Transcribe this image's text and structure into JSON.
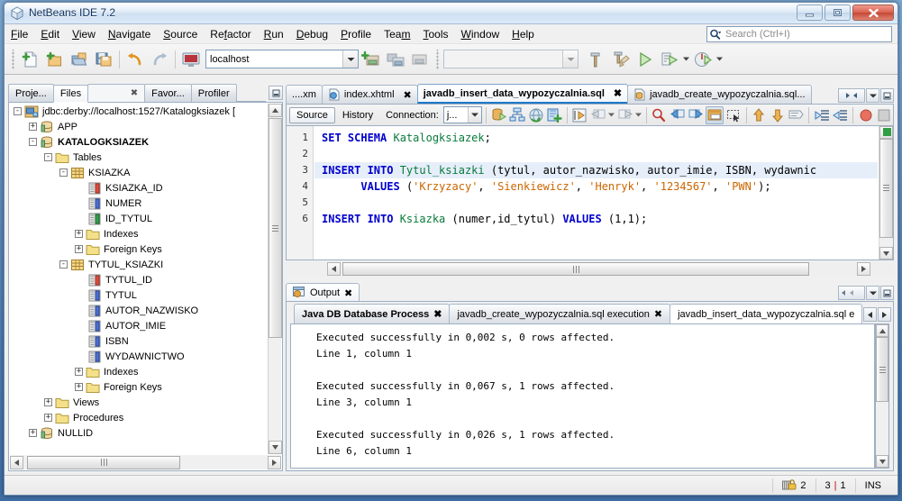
{
  "window": {
    "title": "NetBeans IDE 7.2",
    "app_icon": "netbeans-cube-icon",
    "minimize": "minimize-icon",
    "maximize": "maximize-icon",
    "close": "close-icon"
  },
  "menubar": {
    "items": [
      {
        "label": "File",
        "mnemonic": "F"
      },
      {
        "label": "Edit",
        "mnemonic": "E"
      },
      {
        "label": "View",
        "mnemonic": "V"
      },
      {
        "label": "Navigate",
        "mnemonic": "N"
      },
      {
        "label": "Source",
        "mnemonic": "S"
      },
      {
        "label": "Refactor",
        "mnemonic": "R"
      },
      {
        "label": "Run",
        "mnemonic": "R"
      },
      {
        "label": "Debug",
        "mnemonic": "D"
      },
      {
        "label": "Profile",
        "mnemonic": "P"
      },
      {
        "label": "Team",
        "mnemonic": "m"
      },
      {
        "label": "Tools",
        "mnemonic": "T"
      },
      {
        "label": "Window",
        "mnemonic": "W"
      },
      {
        "label": "Help",
        "mnemonic": "H"
      }
    ]
  },
  "search": {
    "placeholder": "Search (Ctrl+I)",
    "value": "",
    "icon": "search-magnifier-icon"
  },
  "toolbar": {
    "buttons": [
      {
        "name": "new-file-button",
        "icon": "new-file-icon"
      },
      {
        "name": "new-project-button",
        "icon": "new-project-icon"
      },
      {
        "name": "open-project-button",
        "icon": "open-project-icon"
      },
      {
        "name": "save-all-button",
        "icon": "save-all-icon"
      },
      {
        "name": "undo-button",
        "icon": "undo-arrow-icon"
      },
      {
        "name": "redo-button",
        "icon": "redo-arrow-icon"
      }
    ],
    "config_combo": {
      "value": "localhost",
      "name": "server-config-combo"
    },
    "project_combo": {
      "value": "",
      "name": "project-config-combo"
    },
    "right_buttons": [
      {
        "name": "build-project-button",
        "icon": "hammer-icon"
      },
      {
        "name": "clean-build-button",
        "icon": "hammer-broom-icon"
      },
      {
        "name": "run-project-button",
        "icon": "green-play-icon"
      },
      {
        "name": "debug-project-button",
        "icon": "debug-icon"
      },
      {
        "name": "profile-project-button",
        "icon": "profile-gauge-icon"
      }
    ]
  },
  "explorer": {
    "tabs": [
      {
        "label": "Proje...",
        "name": "tab-projects",
        "active": false,
        "closable": false
      },
      {
        "label": "Files",
        "name": "tab-files",
        "active": true,
        "closable": false
      },
      {
        "label": "Favor...",
        "name": "tab-favorites",
        "active": false,
        "closable": false
      },
      {
        "label": "Profiler",
        "name": "tab-profiler",
        "active": false,
        "closable": false
      }
    ],
    "close_marker": "✖",
    "minimize_icon": "minimize-window-icon",
    "tree": [
      {
        "label": "jdbc:derby://localhost:1527/Katalogksiazek [",
        "indent": 1,
        "expander": "-",
        "icon": "database-connection-icon",
        "bold": false
      },
      {
        "label": "APP",
        "indent": 2,
        "expander": "+",
        "icon": "schema-icon",
        "bold": false
      },
      {
        "label": "KATALOGKSIAZEK",
        "indent": 2,
        "expander": "-",
        "icon": "schema-icon",
        "bold": true
      },
      {
        "label": "Tables",
        "indent": 3,
        "expander": "-",
        "icon": "folder-icon",
        "bold": false
      },
      {
        "label": "KSIAZKA",
        "indent": 4,
        "expander": "-",
        "icon": "table-icon",
        "bold": false
      },
      {
        "label": "KSIAZKA_ID",
        "indent": 5,
        "expander": "",
        "icon": "column-key-red-icon",
        "bold": false
      },
      {
        "label": "NUMER",
        "indent": 5,
        "expander": "",
        "icon": "column-blue-icon",
        "bold": false
      },
      {
        "label": "ID_TYTUL",
        "indent": 5,
        "expander": "",
        "icon": "column-green-icon",
        "bold": false
      },
      {
        "label": "Indexes",
        "indent": 5,
        "expander": "+",
        "icon": "folder-icon",
        "bold": false
      },
      {
        "label": "Foreign Keys",
        "indent": 5,
        "expander": "+",
        "icon": "folder-icon",
        "bold": false
      },
      {
        "label": "TYTUL_KSIAZKI",
        "indent": 4,
        "expander": "-",
        "icon": "table-icon",
        "bold": false
      },
      {
        "label": "TYTUL_ID",
        "indent": 5,
        "expander": "",
        "icon": "column-key-red-icon",
        "bold": false
      },
      {
        "label": "TYTUL",
        "indent": 5,
        "expander": "",
        "icon": "column-blue-icon",
        "bold": false
      },
      {
        "label": "AUTOR_NAZWISKO",
        "indent": 5,
        "expander": "",
        "icon": "column-blue-icon",
        "bold": false
      },
      {
        "label": "AUTOR_IMIE",
        "indent": 5,
        "expander": "",
        "icon": "column-blue-icon",
        "bold": false
      },
      {
        "label": "ISBN",
        "indent": 5,
        "expander": "",
        "icon": "column-blue-icon",
        "bold": false
      },
      {
        "label": "WYDAWNICTWO",
        "indent": 5,
        "expander": "",
        "icon": "column-blue-icon",
        "bold": false
      },
      {
        "label": "Indexes",
        "indent": 5,
        "expander": "+",
        "icon": "folder-icon",
        "bold": false
      },
      {
        "label": "Foreign Keys",
        "indent": 5,
        "expander": "+",
        "icon": "folder-icon",
        "bold": false
      },
      {
        "label": "Views",
        "indent": 3,
        "expander": "+",
        "icon": "folder-icon",
        "bold": false
      },
      {
        "label": "Procedures",
        "indent": 3,
        "expander": "+",
        "icon": "folder-icon",
        "bold": false
      },
      {
        "label": "NULLID",
        "indent": 2,
        "expander": "+",
        "icon": "schema-icon",
        "bold": false
      }
    ]
  },
  "editor": {
    "tabs": [
      {
        "label": "....xm",
        "name": "editor-tab-xml",
        "active": false,
        "closable": false,
        "icon": ""
      },
      {
        "label": "index.xhtml",
        "name": "editor-tab-index-xhtml",
        "active": false,
        "closable": true,
        "icon": "xhtml-file-icon"
      },
      {
        "label": "javadb_insert_data_wypozyczalnia.sql",
        "name": "editor-tab-insert-sql",
        "active": true,
        "closable": true,
        "icon": ""
      },
      {
        "label": "javadb_create_wypozyczalnia.sql...",
        "name": "editor-tab-create-sql",
        "active": false,
        "closable": false,
        "icon": "sql-file-icon"
      }
    ],
    "close_marker": "✖",
    "nav": {
      "prev": "scroll-tabs-left-icon",
      "next": "scroll-tabs-right-icon",
      "list": "tab-list-dropdown-icon",
      "maximize": "maximize-window-icon"
    },
    "toolbar": {
      "source_label": "Source",
      "history_label": "History",
      "connection_label": "Connection:",
      "connection_value": "j...",
      "buttons": [
        {
          "name": "run-sql-button",
          "icon": "run-sql-icon"
        },
        {
          "name": "sql-design-button",
          "icon": "sql-design-icon"
        },
        {
          "name": "refresh-button",
          "icon": "refresh-globe-icon"
        },
        {
          "name": "add-database-button",
          "icon": "add-database-icon"
        },
        {
          "name": "toggle-bookmark-button",
          "icon": "toggle-bookmark-icon"
        },
        {
          "name": "previous-bookmark-button",
          "icon": "previous-bookmark-icon"
        },
        {
          "name": "next-bookmark-button",
          "icon": "next-bookmark-icon"
        },
        {
          "name": "find-selection-button",
          "icon": "find-selection-icon"
        },
        {
          "name": "find-previous-button",
          "icon": "find-previous-icon"
        },
        {
          "name": "find-next-button",
          "icon": "find-next-icon"
        },
        {
          "name": "toggle-highlight-button",
          "icon": "toggle-highlight-search-icon"
        },
        {
          "name": "toggle-rectangular-selection-button",
          "icon": "rectangular-selection-icon"
        },
        {
          "name": "previous-error-button",
          "icon": "previous-error-up-icon"
        },
        {
          "name": "next-error-button",
          "icon": "next-error-down-icon"
        },
        {
          "name": "comment-button",
          "icon": "comment-icon"
        },
        {
          "name": "shift-left-button",
          "icon": "shift-line-left-icon"
        },
        {
          "name": "shift-right-button",
          "icon": "shift-line-right-icon"
        },
        {
          "name": "stop-button",
          "icon": "stop-record-icon"
        },
        {
          "name": "macro-button",
          "icon": "macro-square-icon"
        }
      ]
    },
    "code": {
      "lines": [
        {
          "num": "1",
          "highlight": false,
          "tokens": [
            {
              "t": "SET SCHEMA ",
              "c": "kw"
            },
            {
              "t": "Katalogksiazek",
              "c": "tbl"
            },
            {
              "t": ";",
              "c": "plain"
            }
          ]
        },
        {
          "num": "2",
          "highlight": false,
          "tokens": []
        },
        {
          "num": "3",
          "highlight": true,
          "tokens": [
            {
              "t": "INSERT INTO ",
              "c": "kw"
            },
            {
              "t": "Tytul_ksiazki ",
              "c": "tbl"
            },
            {
              "t": "(tytul, autor_nazwisko, autor_imie, ISBN, wydawnic",
              "c": "plain"
            }
          ]
        },
        {
          "num": "4",
          "highlight": false,
          "tokens": [
            {
              "t": "      ",
              "c": "plain"
            },
            {
              "t": "VALUES ",
              "c": "kw"
            },
            {
              "t": "(",
              "c": "plain"
            },
            {
              "t": "'Krzyzacy'",
              "c": "str"
            },
            {
              "t": ", ",
              "c": "plain"
            },
            {
              "t": "'Sienkiewicz'",
              "c": "str"
            },
            {
              "t": ", ",
              "c": "plain"
            },
            {
              "t": "'Henryk'",
              "c": "str"
            },
            {
              "t": ", ",
              "c": "plain"
            },
            {
              "t": "'1234567'",
              "c": "str"
            },
            {
              "t": ", ",
              "c": "plain"
            },
            {
              "t": "'PWN'",
              "c": "str"
            },
            {
              "t": ");",
              "c": "plain"
            }
          ]
        },
        {
          "num": "5",
          "highlight": false,
          "tokens": []
        },
        {
          "num": "6",
          "highlight": false,
          "tokens": [
            {
              "t": "INSERT INTO ",
              "c": "kw"
            },
            {
              "t": "Ksiazka ",
              "c": "tbl"
            },
            {
              "t": "(numer,id_tytul) ",
              "c": "plain"
            },
            {
              "t": "VALUES ",
              "c": "kw"
            },
            {
              "t": "(1,1);",
              "c": "plain"
            }
          ]
        }
      ]
    }
  },
  "output": {
    "window_tab": {
      "label": "Output",
      "icon": "output-window-icon",
      "close_marker": "✖"
    },
    "nav": {
      "prev": "scroll-tabs-left-icon",
      "next": "scroll-tabs-right-icon",
      "list": "tab-list-dropdown-icon",
      "maximize": "maximize-window-icon"
    },
    "tabs": [
      {
        "label": "Java DB Database Process",
        "name": "output-tab-java-db-process",
        "active": false,
        "bold": true,
        "closable": true
      },
      {
        "label": "javadb_create_wypozyczalnia.sql execution",
        "name": "output-tab-create-sql-exec",
        "active": false,
        "bold": false,
        "closable": true
      },
      {
        "label": "javadb_insert_data_wypozyczalnia.sql e",
        "name": "output-tab-insert-sql-exec",
        "active": true,
        "bold": false,
        "closable": false
      }
    ],
    "close_marker": "✖",
    "lines": [
      "Executed successfully in 0,002 s, 0 rows affected.",
      "Line 1, column 1",
      "",
      "Executed successfully in 0,067 s, 1 rows affected.",
      "Line 3, column 1",
      "",
      "Executed successfully in 0,026 s, 1 rows affected.",
      "Line 6, column 1"
    ]
  },
  "statusbar": {
    "notifications_icon": "notifications-lock-icon",
    "notifications_count": "2",
    "cursor_line": "3",
    "cursor_separator": "|",
    "cursor_column": "1",
    "insert_mode": "INS"
  },
  "colors": {
    "accent": "#1e78c8",
    "keyword": "#0000cd",
    "table": "#0a7a3c",
    "string": "#cc6600",
    "selection": "#e6eefa",
    "titlebar": "#cfe0f2"
  }
}
